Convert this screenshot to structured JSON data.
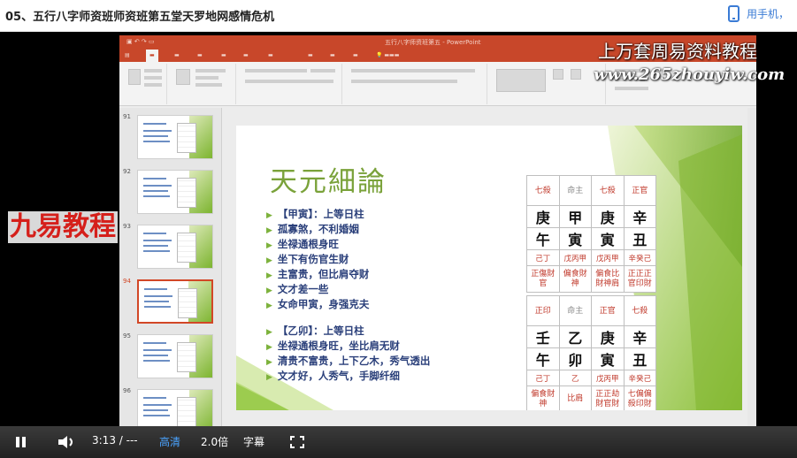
{
  "header": {
    "video_title": "05、五行八字师资班师资班第五堂天罗地网感情危机",
    "phone_label": "用手机，"
  },
  "watermarks": {
    "top_line": "上万套周易资料教程",
    "url": "www.265zhouyiw.com",
    "left_logo": "九易教程"
  },
  "ppt": {
    "window_title": "五行八字师资班第五 - PowerPoint",
    "thumbnail_numbers": [
      "91",
      "92",
      "93",
      "94",
      "95",
      "96"
    ],
    "selected_thumbnail": "94"
  },
  "slide": {
    "title": "天元細論",
    "bullets_group1": [
      "【甲寅】：上等日柱",
      "孤寡煞，不利婚姻",
      "坐禄通根身旺",
      "坐下有伤官生财",
      "主富贵，但比肩夺财",
      "文才差一些",
      "女命甲寅，身强克夫"
    ],
    "bullets_group2": [
      "【乙卯】：上等日柱",
      "坐禄通根身旺，坐比肩无财",
      "清贵不富贵，上下乙木，秀气透出",
      "文才好，人秀气，手脚纤细"
    ]
  },
  "chart1": {
    "headers": [
      "七殺",
      "命主",
      "七殺",
      "正官"
    ],
    "stems": [
      "庚",
      "甲",
      "庚",
      "辛"
    ],
    "branches": [
      "午",
      "寅",
      "寅",
      "丑"
    ],
    "hidden": [
      "己丁",
      "戊丙甲",
      "戊丙甲",
      "辛癸己"
    ],
    "gods": [
      "正傷財官",
      "偏食財神",
      "偏食比財神肩",
      "正正正官印財"
    ]
  },
  "chart2": {
    "headers": [
      "正印",
      "命主",
      "正官",
      "七殺"
    ],
    "stems": [
      "壬",
      "乙",
      "庚",
      "辛"
    ],
    "branches": [
      "午",
      "卯",
      "寅",
      "丑"
    ],
    "hidden": [
      "己丁",
      "乙",
      "戊丙甲",
      "辛癸己"
    ],
    "gods": [
      "偏食財神",
      "比肩",
      "正正劫財官財",
      "七偏偏殺印財"
    ]
  },
  "player": {
    "time_label": "3:13 / ---",
    "quality_label": "高清",
    "speed_label": "2.0倍",
    "subtitle_label": "字幕",
    "progress": 0.04
  }
}
